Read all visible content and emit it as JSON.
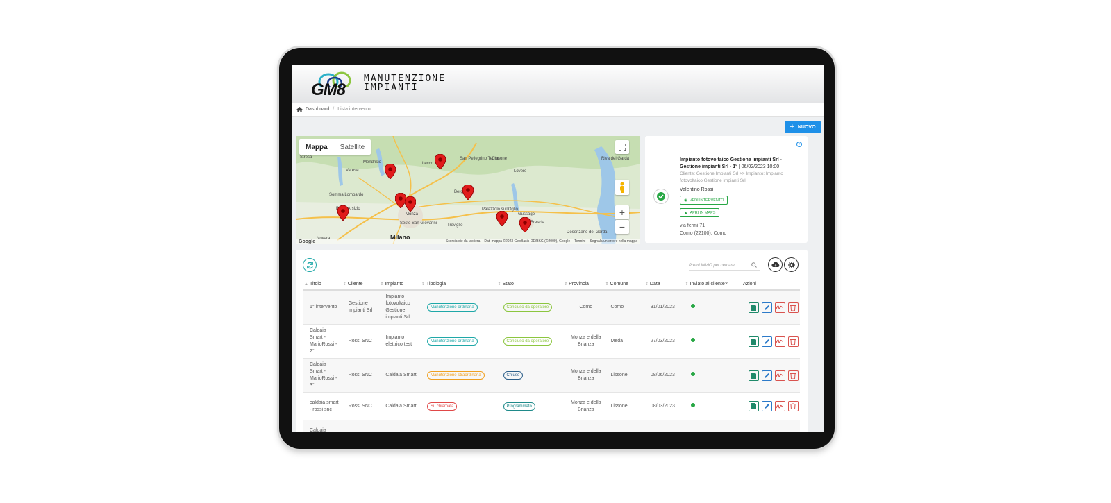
{
  "app": {
    "logo_letters": "GM8",
    "logo_line1": "MANUTENZIONE",
    "logo_line2": "IMPIANTI"
  },
  "breadcrumb": {
    "home": "Dashboard",
    "separator": "/",
    "current": "Lista intervento"
  },
  "toolbar": {
    "new_label": "NUOVO",
    "accent_color": "#1e90e8"
  },
  "map": {
    "type_map": "Mappa",
    "type_satellite": "Satellite",
    "cities": {
      "lecco": "Lecco",
      "varese": "Varese",
      "busto": "Busto Arsizio",
      "monza": "Monza",
      "milano": "Milano",
      "novara": "Novara",
      "bergamo": "Bergamo",
      "brescia": "Brescia",
      "treviglio": "Treviglio",
      "sesto": "Sesto San Giovanni",
      "lovere": "Lovere",
      "clusone": "Clusone",
      "gussago": "Gussago",
      "palazzolo": "Palazzolo sull'Oglio",
      "desenzano": "Desenzano del Garda",
      "riva": "Riva del Garda",
      "somma": "Somma Lombardo",
      "stresa": "Stresa",
      "mendrisio": "Mendrisio",
      "sanpellegrino": "San Pellegrino Terme"
    },
    "footer": {
      "google": "Google",
      "shortcuts": "Scorciatoie da tastiera",
      "data": "Dati mappa ©2023 GeoBasis-DE/BKG (©2009), Google",
      "terms": "Termini",
      "report": "Segnala un errore nella mappa"
    }
  },
  "info_card": {
    "title_bold": "Impianto fotovoltaico Gestione impianti Srl - Gestione impianti Srl - 1°",
    "title_date": "| 06/02/2023 10:00",
    "subtitle": "Cliente: Gestione Impianti Srl >> Impianto: Impianto fotovoltaico Gestione impianti Srl",
    "operator": "Valentino Rossi",
    "view_button": "VEDI INTERVENTO",
    "maps_button": "APRI IN MAPS",
    "address_line1": "via fermi 71",
    "address_line2": "Como (22100), Como"
  },
  "table": {
    "search_placeholder": "Premi INVIO per cercare",
    "headers": {
      "titolo": "Titolo",
      "cliente": "Cliente",
      "impianto": "Impianto",
      "tipologia": "Tipologia",
      "stato": "Stato",
      "provincia": "Provincia",
      "comune": "Comune",
      "data": "Data",
      "inviato": "Inviato al cliente?",
      "azioni": "Azioni"
    },
    "rows": [
      {
        "titolo": "1° intervento",
        "cliente": "Gestione impianti Srl",
        "impianto": "Impianto fotovoltaico Gestione impianti Srl",
        "tipologia": "Manutenzione ordinaria",
        "stato": "Concluso da operatore",
        "provincia": "Como",
        "comune": "Como",
        "data": "31/01/2023"
      },
      {
        "titolo": "Caldaia Smart - MarioRossi - 2°",
        "cliente": "Rossi SNC",
        "impianto": "Impianto elettrico test",
        "tipologia": "Manutenzione ordinaria",
        "stato": "Concluso da operatore",
        "provincia": "Monza e della Brianza",
        "comune": "Meda",
        "data": "27/03/2023"
      },
      {
        "titolo": "Caldaia Smart - MarioRossi - 3°",
        "cliente": "Rossi SNC",
        "impianto": "Caldaia Smart",
        "tipologia": "Manutenzione straordinaria",
        "stato": "Chiuso",
        "provincia": "Monza e della Brianza",
        "comune": "Lissone",
        "data": "08/06/2023"
      },
      {
        "titolo": "caldaia smart - rossi snc",
        "cliente": "Rossi SNC",
        "impianto": "Caldaia Smart",
        "tipologia": "Su chiamata",
        "stato": "Programmato",
        "provincia": "Monza e della Brianza",
        "comune": "Lissone",
        "data": "08/03/2023"
      },
      {
        "titolo": "Caldaia",
        "cliente": "",
        "impianto": "",
        "tipologia": "",
        "stato": "",
        "provincia": "",
        "comune": "",
        "data": ""
      }
    ]
  },
  "colors": {
    "tag_ordinaria": "#1fa8a8",
    "tag_straordinaria": "#f0a020",
    "tag_chiamata": "#e04848",
    "tag_concluso": "#8cc63f",
    "tag_chiuso": "#2c5f8a",
    "tag_programmato": "#1f8a8a",
    "sent_ok": "#28a745"
  }
}
